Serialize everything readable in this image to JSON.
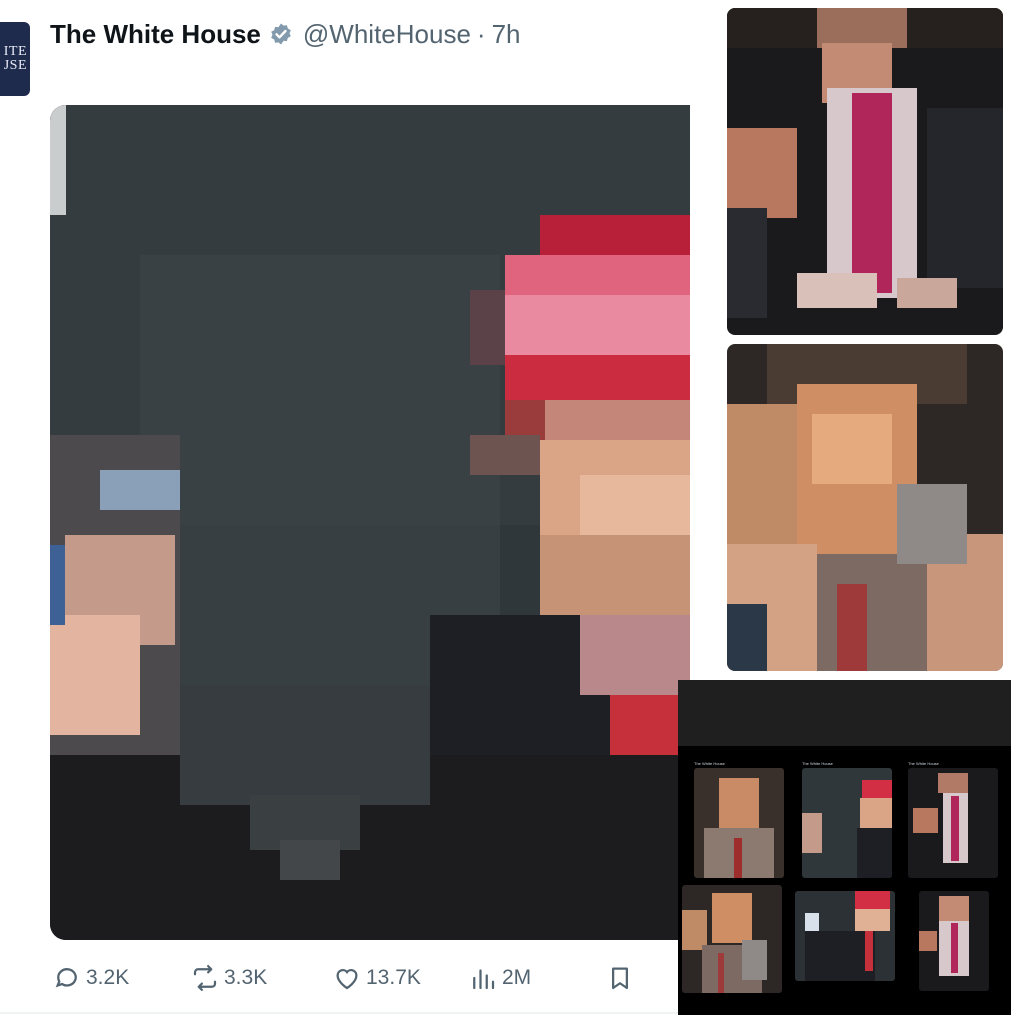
{
  "tweet": {
    "avatar_text_line1": "ITE",
    "avatar_text_line2": "JSE",
    "name": "The White House",
    "handle": "@WhiteHouse",
    "separator": "·",
    "time": "7h",
    "actions": {
      "replies": "3.2K",
      "reposts": "3.3K",
      "likes": "13.7K",
      "views": "2M"
    }
  },
  "icons": {
    "verified": "verified-badge-icon",
    "reply": "reply-bubble-icon",
    "repost": "repost-arrows-icon",
    "like": "heart-icon",
    "views": "bar-chart-icon",
    "bookmark": "bookmark-icon"
  },
  "colors": {
    "text_primary": "#0f1419",
    "text_secondary": "#536471",
    "avatar_bg": "#1f2b4d",
    "verified_badge": "#829aab"
  },
  "collage": {
    "headers": [
      "The White House",
      "The White House",
      "The White House"
    ]
  }
}
